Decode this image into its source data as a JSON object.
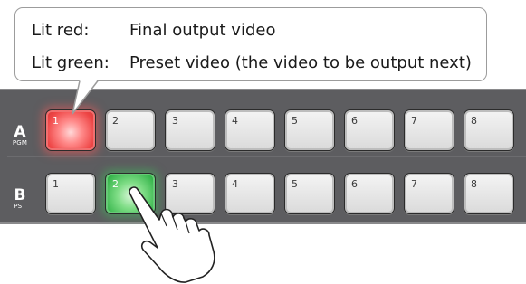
{
  "legend": {
    "items": [
      {
        "key": "Lit red:",
        "text": "Final output video"
      },
      {
        "key": "Lit green:",
        "text": "Preset video (the video to be output next)"
      }
    ]
  },
  "rows": [
    {
      "letter": "A",
      "sub": "PGM",
      "buttons": [
        {
          "label": "1",
          "state": "lit-red"
        },
        {
          "label": "2",
          "state": "off"
        },
        {
          "label": "3",
          "state": "off"
        },
        {
          "label": "4",
          "state": "off"
        },
        {
          "label": "5",
          "state": "off"
        },
        {
          "label": "6",
          "state": "off"
        },
        {
          "label": "7",
          "state": "off"
        },
        {
          "label": "8",
          "state": "off"
        }
      ]
    },
    {
      "letter": "B",
      "sub": "PST",
      "buttons": [
        {
          "label": "1",
          "state": "off"
        },
        {
          "label": "2",
          "state": "lit-green"
        },
        {
          "label": "3",
          "state": "off"
        },
        {
          "label": "4",
          "state": "off"
        },
        {
          "label": "5",
          "state": "off"
        },
        {
          "label": "6",
          "state": "off"
        },
        {
          "label": "7",
          "state": "off"
        },
        {
          "label": "8",
          "state": "off"
        }
      ]
    }
  ],
  "colors": {
    "lit_red": "#ee4545",
    "lit_green": "#34b44a",
    "panel": "#5d5d60"
  },
  "icons": {
    "pointer": "hand-pointer-icon"
  }
}
